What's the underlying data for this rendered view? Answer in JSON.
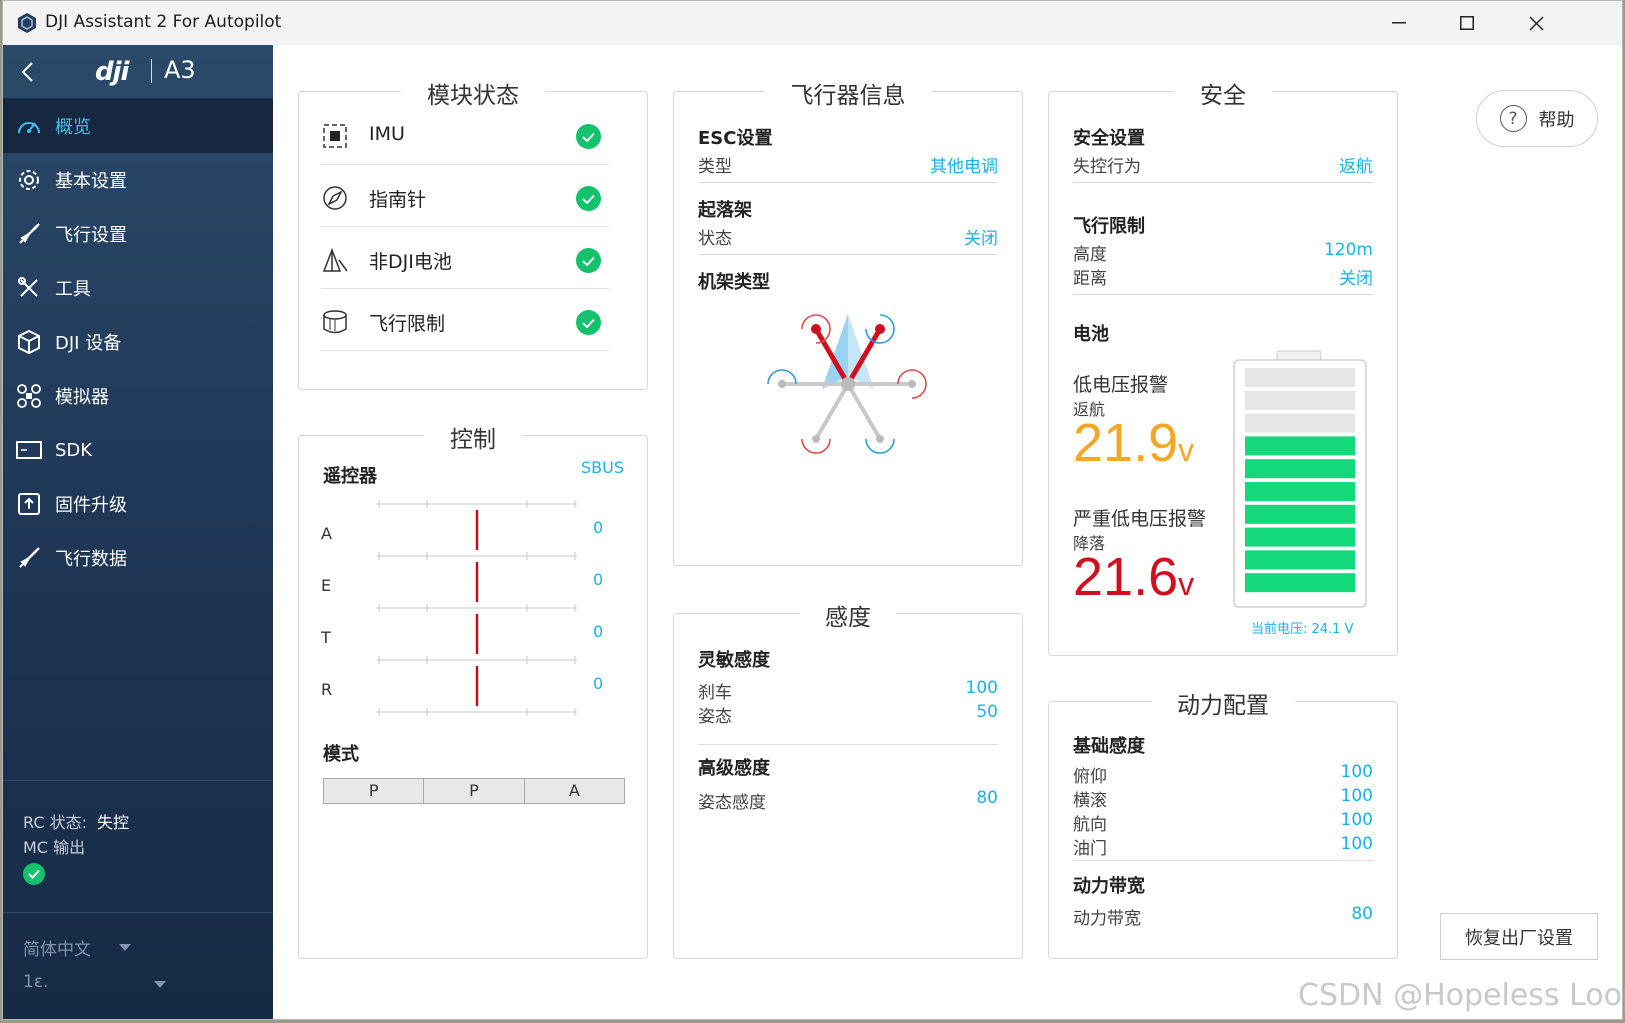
{
  "window": {
    "title": "DJI Assistant 2 For Autopilot"
  },
  "sidebar": {
    "brand": "dji",
    "model": "A3",
    "items": [
      {
        "label": "概览",
        "icon": "gauge-icon"
      },
      {
        "label": "基本设置",
        "icon": "gear-icon"
      },
      {
        "label": "飞行设置",
        "icon": "rocket-icon"
      },
      {
        "label": "工具",
        "icon": "tools-icon"
      },
      {
        "label": "DJI 设备",
        "icon": "cube-icon"
      },
      {
        "label": "模拟器",
        "icon": "drone-icon"
      },
      {
        "label": "SDK",
        "icon": "sdk-icon"
      },
      {
        "label": "固件升级",
        "icon": "firmware-icon"
      },
      {
        "label": "飞行数据",
        "icon": "rocket-icon"
      }
    ],
    "status": {
      "rc_label": "RC 状态:",
      "rc_value": "失控",
      "mc_label": "MC 输出"
    },
    "language": "简体中文",
    "version": "1ε."
  },
  "module_status": {
    "title": "模块状态",
    "items": [
      {
        "label": "IMU",
        "icon": "imu-icon"
      },
      {
        "label": "指南针",
        "icon": "compass-icon"
      },
      {
        "label": "非DJI电池",
        "icon": "battery-icon"
      },
      {
        "label": "飞行限制",
        "icon": "cylinder-icon"
      }
    ]
  },
  "control": {
    "title": "控制",
    "rc_title": "遥控器",
    "rc_protocol": "SBUS",
    "channels": [
      {
        "label": "A",
        "value": "0"
      },
      {
        "label": "E",
        "value": "0"
      },
      {
        "label": "T",
        "value": "0"
      },
      {
        "label": "R",
        "value": "0"
      }
    ],
    "mode_title": "模式",
    "modes": [
      "P",
      "P",
      "A"
    ]
  },
  "aircraft_info": {
    "title": "飞行器信息",
    "esc_title": "ESC设置",
    "esc_type_label": "类型",
    "esc_type_value": "其他电调",
    "gear_title": "起落架",
    "gear_state_label": "状态",
    "gear_state_value": "关闭",
    "frame_title": "机架类型"
  },
  "gain": {
    "title": "感度",
    "basic_title": "灵敏感度",
    "brake_label": "刹车",
    "brake_value": "100",
    "attitude_label": "姿态",
    "attitude_value": "50",
    "advanced_title": "高级感度",
    "adv_attitude_label": "姿态感度",
    "adv_attitude_value": "80"
  },
  "safety": {
    "title": "安全",
    "settings_title": "安全设置",
    "failsafe_label": "失控行为",
    "failsafe_value": "返航",
    "limits_title": "飞行限制",
    "height_label": "高度",
    "height_value": "120m",
    "distance_label": "距离",
    "distance_value": "关闭",
    "battery_title": "电池",
    "low_label": "低电压报警",
    "low_action": "返航",
    "low_value": "21.9",
    "low_unit": "v",
    "critical_label": "严重低电压报警",
    "critical_action": "降落",
    "critical_value": "21.6",
    "critical_unit": "v",
    "current_voltage": "当前电压: 24.1 V",
    "battery_level_fraction": 0.7
  },
  "power": {
    "title": "动力配置",
    "basic_title": "基础感度",
    "pitch_label": "俯仰",
    "pitch_value": "100",
    "roll_label": "横滚",
    "roll_value": "100",
    "yaw_label": "航向",
    "yaw_value": "100",
    "throttle_label": "油门",
    "throttle_value": "100",
    "bandwidth_title": "动力带宽",
    "bandwidth_label": "动力带宽",
    "bandwidth_value": "80"
  },
  "buttons": {
    "help": "帮助",
    "reset": "恢复出厂设置"
  },
  "watermark": "CSDN @Hopeless Loop",
  "colors": {
    "accent": "#1ab2ea",
    "ok": "#13c26b",
    "warning": "#f5a623",
    "critical": "#d0101e",
    "battery_fill": "#13d97a"
  }
}
